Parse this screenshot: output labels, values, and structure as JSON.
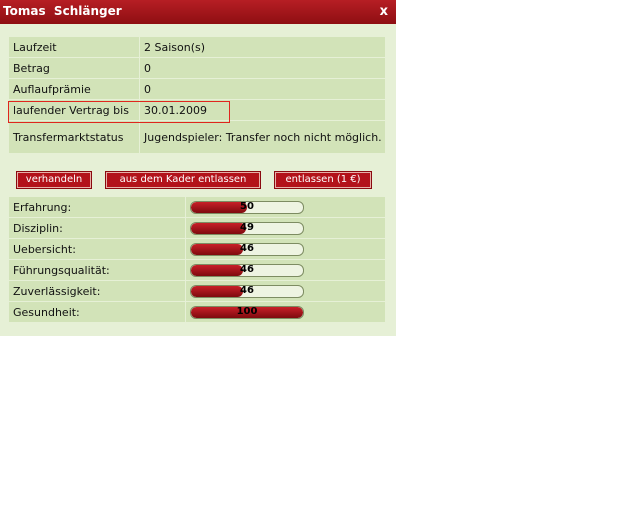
{
  "window": {
    "title": "Tomas  Schlänger",
    "close_label": "x"
  },
  "contract": [
    {
      "label": "Laufzeit",
      "value": "2 Saison(s)"
    },
    {
      "label": "Betrag",
      "value": "0"
    },
    {
      "label": "Auflaufprämie",
      "value": "0"
    },
    {
      "label": "laufender Vertrag bis",
      "value": "30.01.2009"
    },
    {
      "label": "Transfermarktstatus",
      "value": "Jugendspieler: Transfer noch nicht möglich."
    }
  ],
  "actions": {
    "negotiate": "verhandeln",
    "release_from_squad": "aus dem Kader entlassen",
    "dismiss": "entlassen (1 €)"
  },
  "skills": [
    {
      "label": "Erfahrung:",
      "value": "50",
      "fill_percent": 50
    },
    {
      "label": "Disziplin:",
      "value": "49",
      "fill_percent": 49
    },
    {
      "label": "Uebersicht:",
      "value": "46",
      "fill_percent": 46
    },
    {
      "label": "Führungsqualität:",
      "value": "46",
      "fill_percent": 46
    },
    {
      "label": "Zuverlässigkeit:",
      "value": "46",
      "fill_percent": 46
    },
    {
      "label": "Gesundheit:",
      "value": "100",
      "fill_percent": 100
    }
  ],
  "colors": {
    "accent": "#b3121a",
    "highlight_border": "#e0261e",
    "panel": "#e6f0d6",
    "row": "#d2e3b8"
  }
}
